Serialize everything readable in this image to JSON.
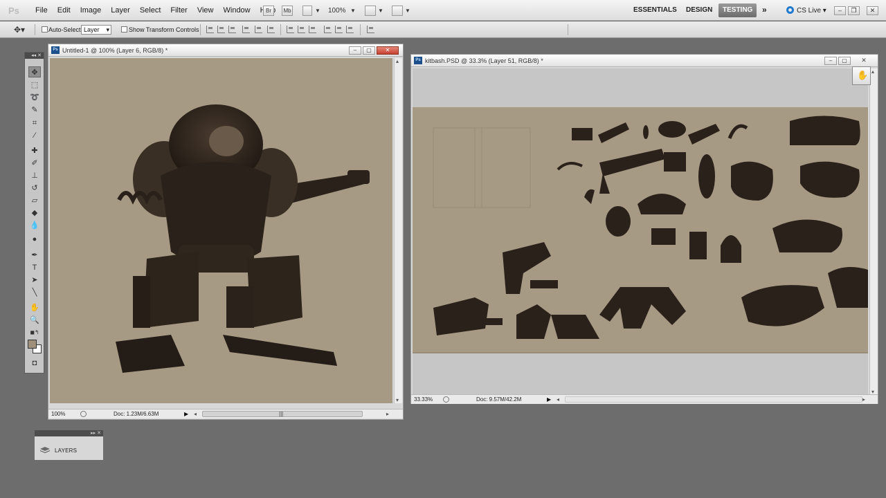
{
  "menubar": {
    "logo": "Ps",
    "items": [
      "File",
      "Edit",
      "Image",
      "Layer",
      "Select",
      "Filter",
      "View",
      "Window",
      "Help"
    ],
    "bridge_label": "Br",
    "mini_label": "Mb",
    "zoom": "100%",
    "workspaces": [
      "ESSENTIALS",
      "DESIGN",
      "TESTING"
    ],
    "active_workspace": "TESTING",
    "cslive": "CS Live"
  },
  "options": {
    "auto_select_label": "Auto-Select:",
    "auto_select_value": "Layer",
    "show_transform_label": "Show Transform Controls"
  },
  "doc1": {
    "title": "Untitled-1 @ 100% (Layer 6, RGB/8) *",
    "zoom": "100%",
    "docsize": "Doc: 1.23M/6.63M",
    "badge": "Ps"
  },
  "doc2": {
    "title": "kitbash.PSD @ 33.3% (Layer 51, RGB/8) *",
    "zoom": "33.33%",
    "docsize": "Doc: 9.57M/42.2M",
    "badge": "Ps"
  },
  "layers_panel": {
    "label": "LAYERS"
  },
  "colors": {
    "canvas_tan": "#a79a84",
    "silhouette": "#2a211a",
    "foreground_swatch": "#9e907a"
  }
}
